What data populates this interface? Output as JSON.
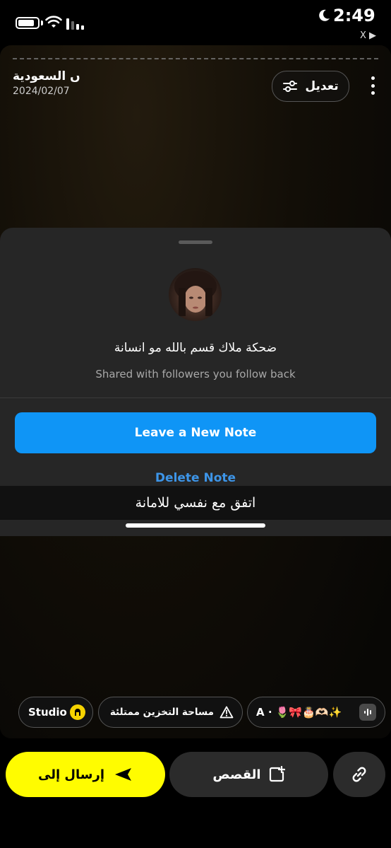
{
  "status_bar": {
    "time": "2:49",
    "indicator": "X ▶"
  },
  "snap": {
    "location": "ں السعودية",
    "date": "2024/02/07",
    "edit_label": "تعديل",
    "icons": {
      "edit": "sliders-icon",
      "more": "more-vertical-icon"
    }
  },
  "note_sheet": {
    "note_text": "ضحكة ملاك قسم بالله مو انسانة",
    "audience": "Shared with followers you follow back",
    "leave_button": "Leave a New Note",
    "delete_button": "Delete Note"
  },
  "caption": "اتفق مع نفسي للامانة",
  "chips": {
    "studio_label": "Studio",
    "storage_label": "مساحة التخزين ممتلئة",
    "music_label": "A · 🌷🎀🎂🫶🏻✨"
  },
  "bottom_bar": {
    "send_label": "إرسال إلى",
    "stories_label": "القصص"
  },
  "colors": {
    "send_button": "#fffc00",
    "leave_button": "#0f95f6",
    "delete_text": "#3d95e8",
    "sheet_bg": "#262626"
  }
}
